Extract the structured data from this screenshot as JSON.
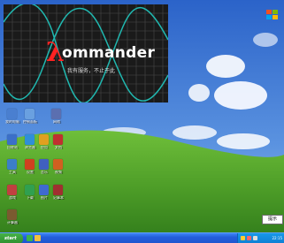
{
  "splash": {
    "logo_symbol": "λ",
    "logo_text": "ommander",
    "subtitle": "我有服务，不止于此"
  },
  "desktop_icons": [
    {
      "label": "我的电脑",
      "color": "#4a7fd0"
    },
    {
      "label": "控制面板",
      "color": "#6aa0e0"
    },
    {
      "label": "网络",
      "color": "#5b6fb0"
    },
    {
      "label": "回收站",
      "color": "#3b6fc8"
    },
    {
      "label": "浏览器",
      "color": "#2f8fd8"
    },
    {
      "label": "应用",
      "color": "#e0a020"
    },
    {
      "label": "文档",
      "color": "#2a5fc0"
    },
    {
      "label": "工具",
      "color": "#c03030"
    },
    {
      "label": "设置",
      "color": "#3c7ec8"
    },
    {
      "label": "音乐",
      "color": "#d04020"
    },
    {
      "label": "视频",
      "color": "#4060c0"
    },
    {
      "label": "游戏",
      "color": "#d06020"
    },
    {
      "label": "下载",
      "color": "#c04040"
    },
    {
      "label": "图片",
      "color": "#30a050"
    },
    {
      "label": "记事本",
      "color": "#3f6ad0"
    },
    {
      "label": "计算器",
      "color": "#a03030"
    }
  ],
  "popup": {
    "text": "提示"
  },
  "taskbar": {
    "start_label": "start",
    "clock": "22:15"
  }
}
